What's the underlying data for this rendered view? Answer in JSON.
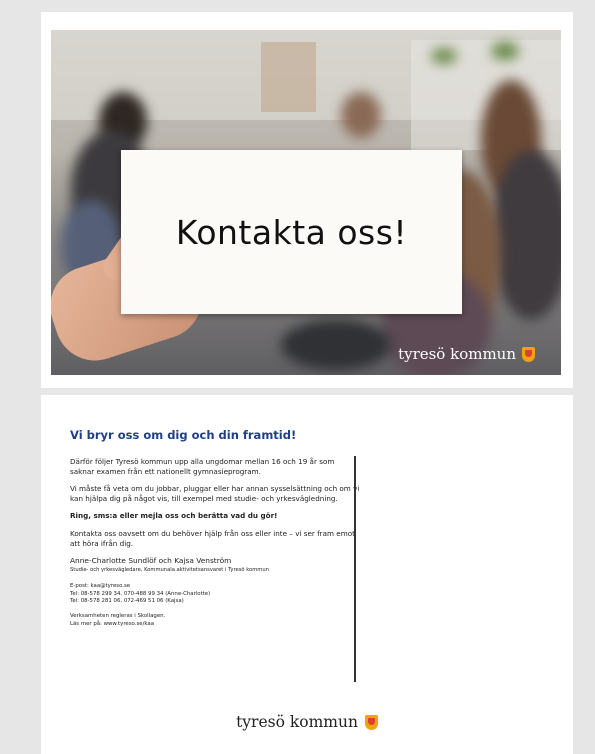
{
  "front": {
    "card_title": "Kontakta oss!",
    "brand": "tyresö kommun"
  },
  "back": {
    "heading": "Vi bryr oss om dig och din framtid!",
    "paragraphs": [
      "Därför följer Tyresö kommun upp alla ungdomar mellan 16 och 19 år som saknar examen från ett nationellt gymnasieprogram.",
      "Vi måste få veta om du jobbar, pluggar eller har annan sysselsättning och om vi kan hjälpa dig på något vis, till exempel med studie- och yrkesvägledning.",
      "Ring, sms:a eller mejla oss och berätta vad du gör!",
      "Kontakta oss oavsett om du behöver hjälp från oss eller inte – vi ser fram emot att höra ifrån dig."
    ],
    "signature": {
      "names": "Anne-Charlotte Sundlöf och Kajsa Venström",
      "role": "Studie- och yrkesvägledare, Kommunala aktivitetsansvaret i Tyresö kommun"
    },
    "contact": {
      "email": "E-post: kaa@tyreso.se",
      "phone1": "Tel: 08-578 299 34, 070-488 99 34 (Anne-Charlotte)",
      "phone2": "Tel: 08-578 281 06, 072-469 51 06 (Kajsa)"
    },
    "law": {
      "line1": "Verksamheten regleras i Skollagen.",
      "line2": "Läs mer på: www.tyreso.se/kaa"
    },
    "brand": "tyresö kommun"
  },
  "colors": {
    "heading_blue": "#1f3f86",
    "shield_gold": "#f1a20f",
    "shield_red": "#d9412a"
  },
  "icons": [
    "tyreso-shield-icon"
  ]
}
